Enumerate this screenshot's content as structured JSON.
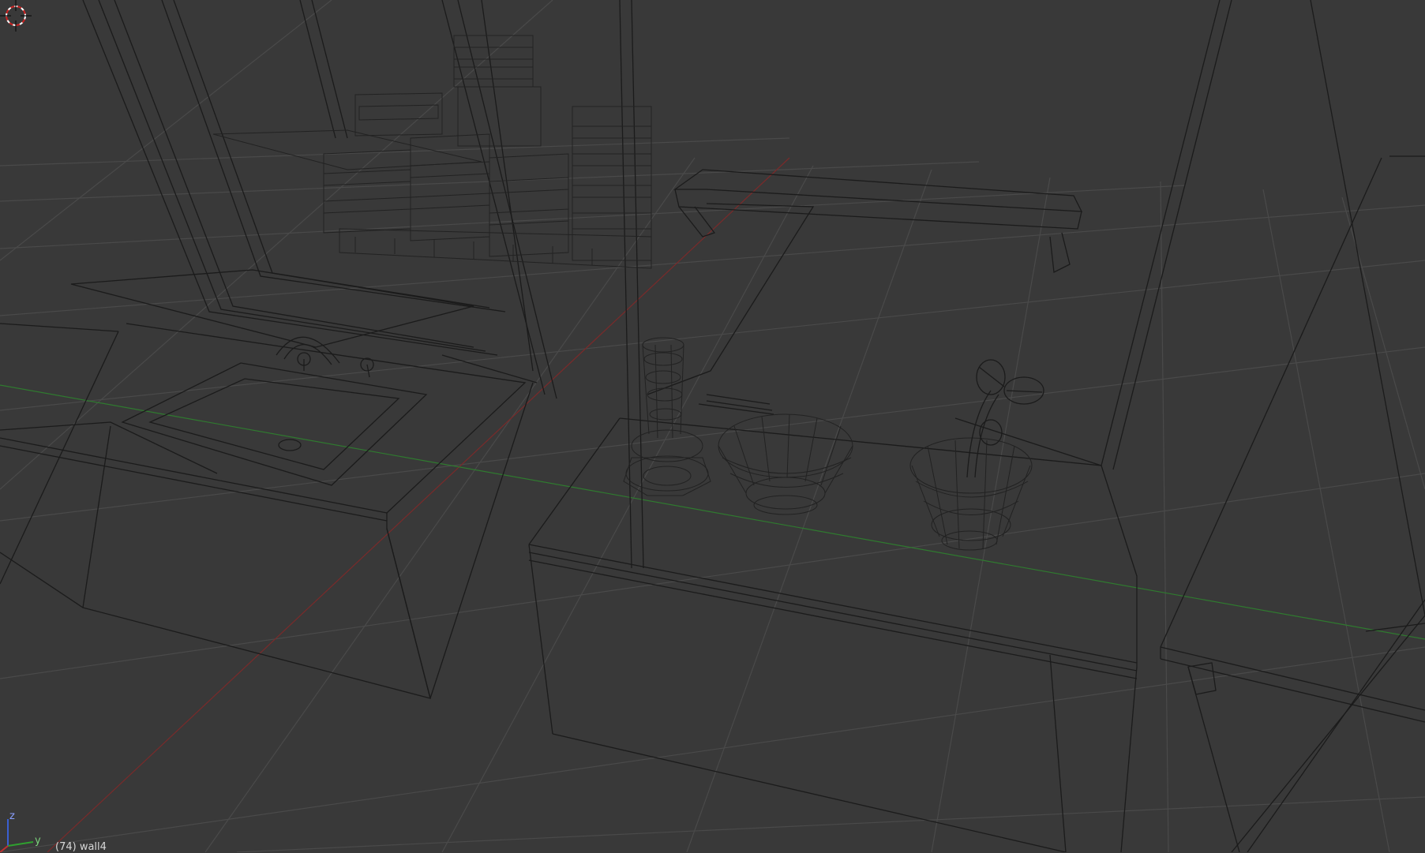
{
  "viewport": {
    "mode": "wireframe",
    "background_color": "#393939",
    "grid_color": "#4a4a4a",
    "wire_color": "#1b1b1b",
    "x_axis_color": "#7a2a2a",
    "y_axis_color": "#2f7a2f"
  },
  "gizmo": {
    "z_label": "z",
    "y_label": "y"
  },
  "status": {
    "view_label": "(74) wall4"
  },
  "scene_objects": [
    "window-frame",
    "shelf-glasses",
    "wall-shelf-bar",
    "sink",
    "faucet",
    "counter-left",
    "counter-center",
    "glass-stack",
    "plate",
    "chopsticks",
    "bowl",
    "plant-pot",
    "plant-leaves",
    "door-frame-right"
  ]
}
